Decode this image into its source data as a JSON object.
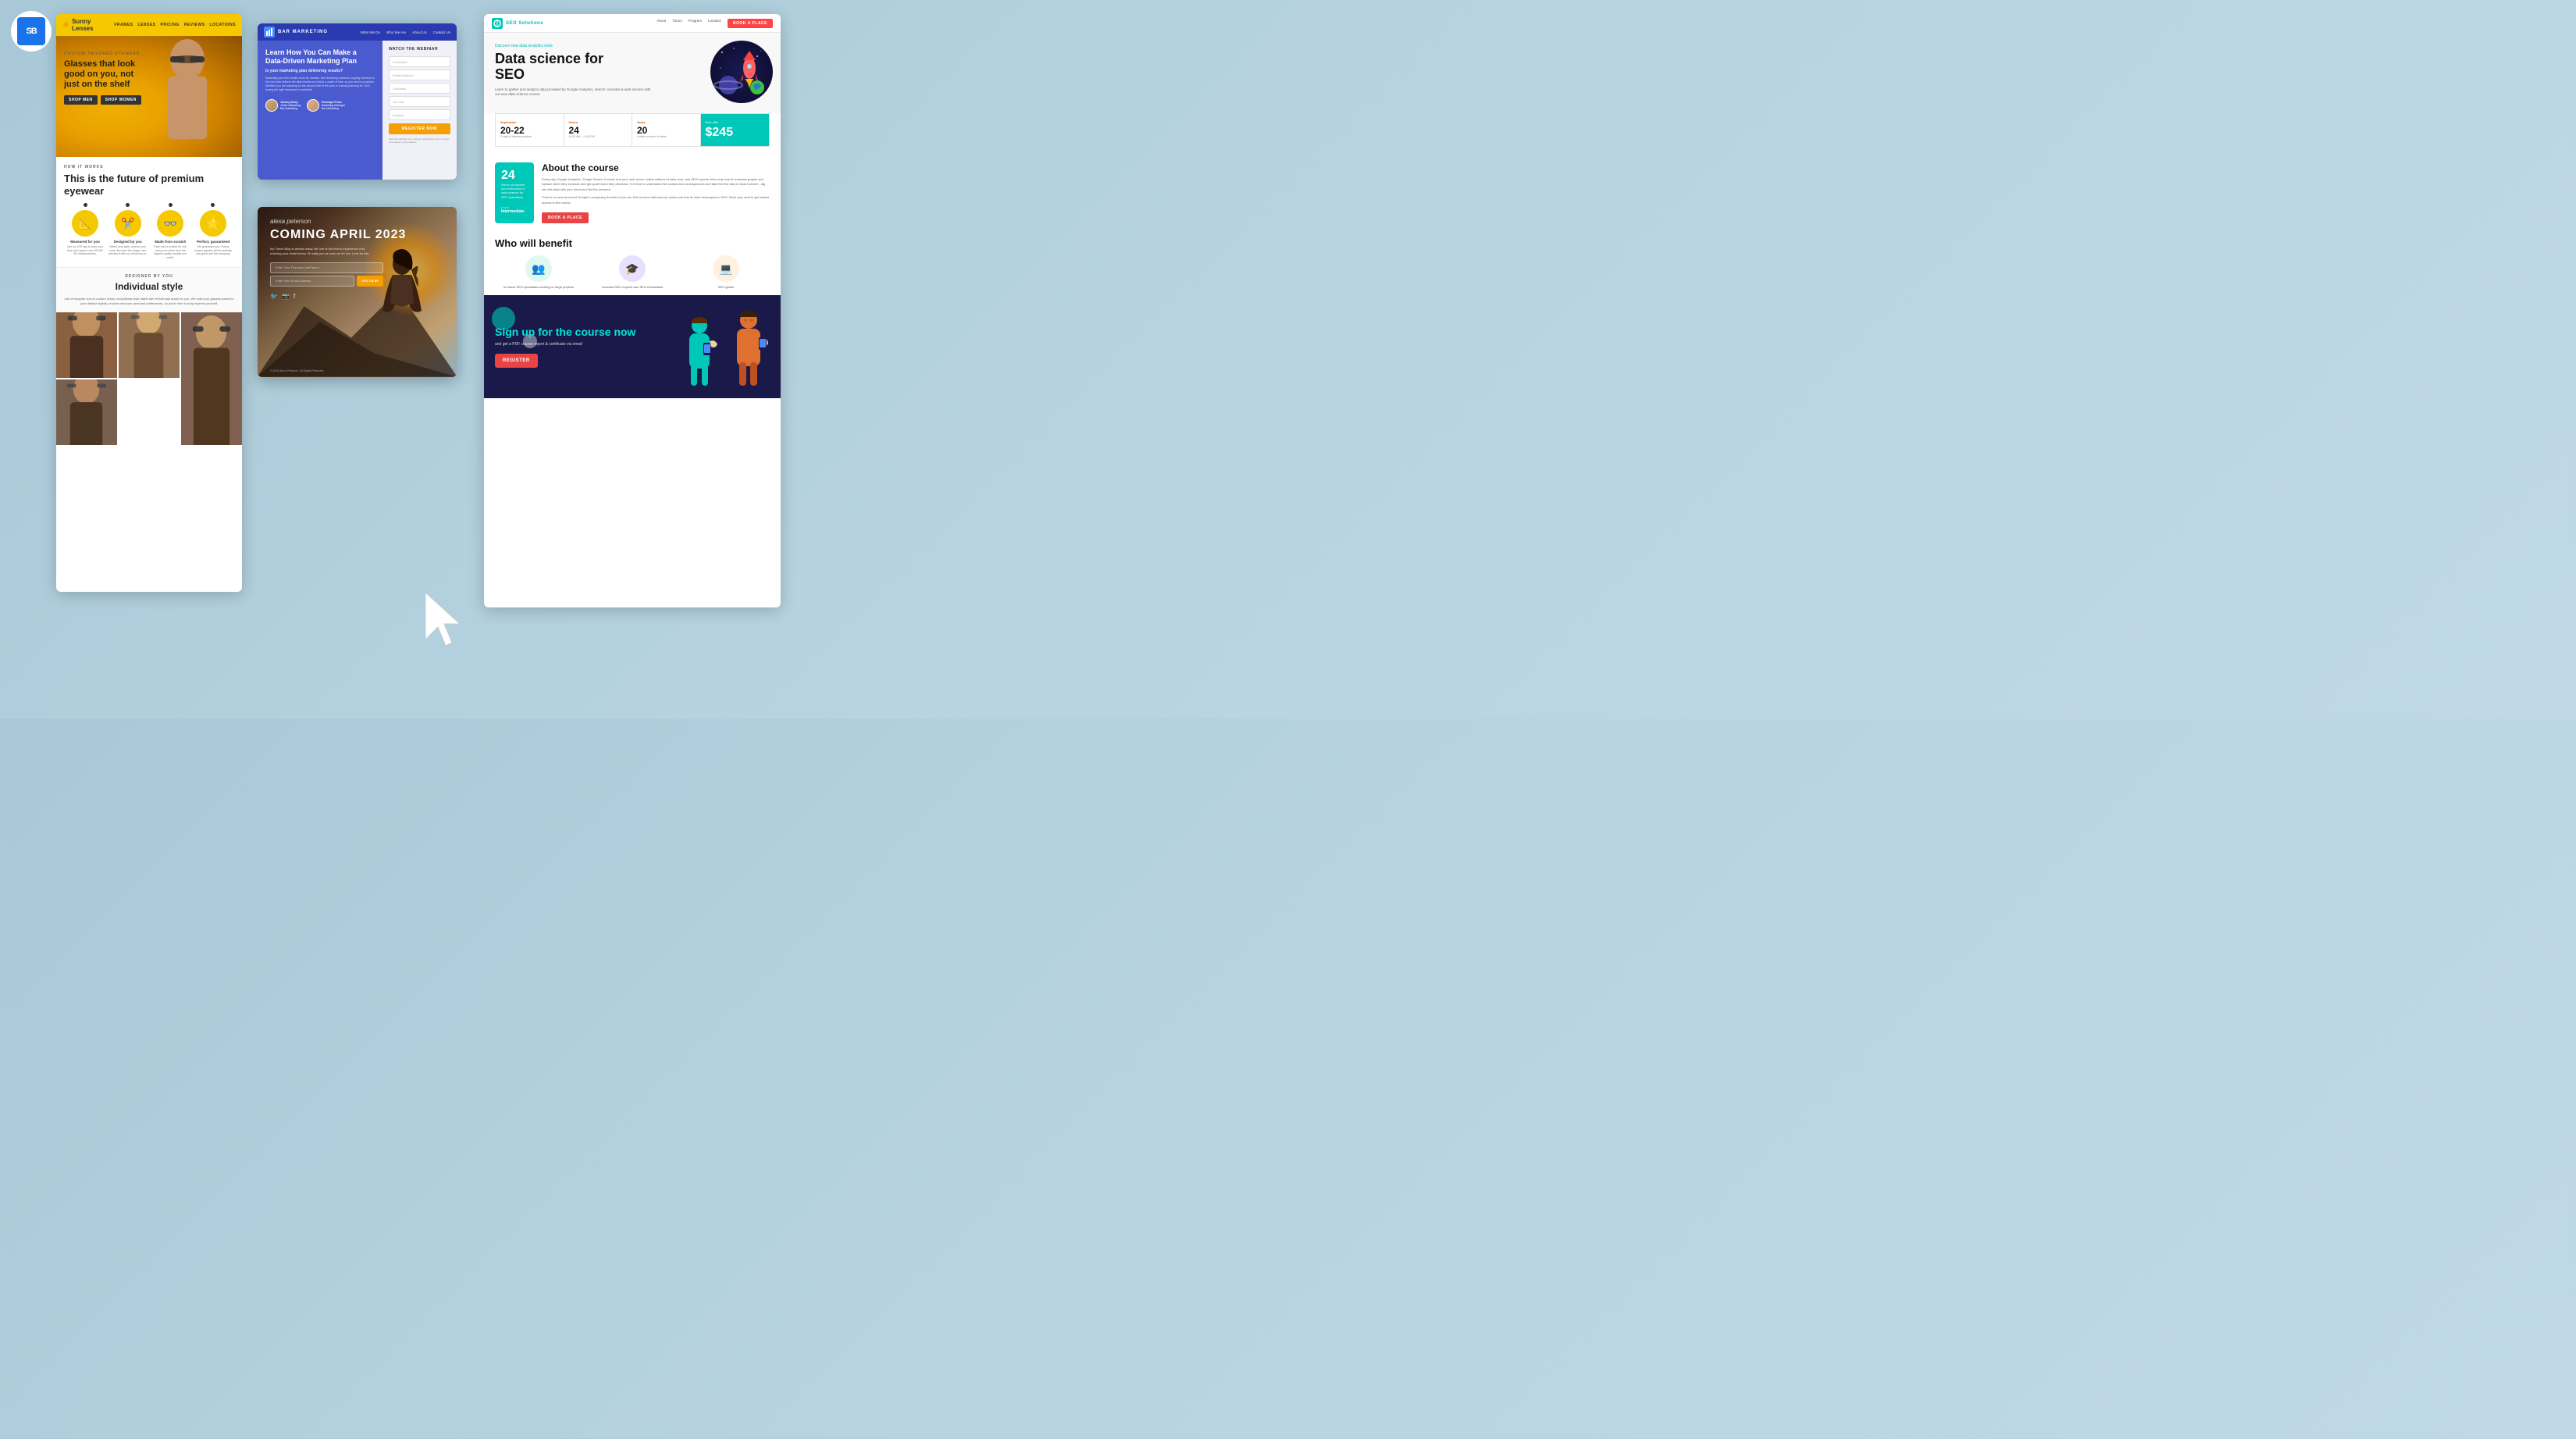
{
  "logo": {
    "text": "SB"
  },
  "panel1": {
    "brand": "Sunny Lenses",
    "nav_items": [
      "FRAMES",
      "LENSES",
      "PRICING",
      "REVIEWS",
      "LOCATIONS"
    ],
    "hero": {
      "custom_label": "CUSTOM-TAILORED EYEWEAR",
      "headline": "Glasses that look good on you, not just on the shelf",
      "btn_men": "SHOP MEN",
      "btn_women": "SHOP WOMEN"
    },
    "how": {
      "label": "HOW IT WORKS",
      "headline": "This is the future of premium eyewear",
      "icons": [
        {
          "emoji": "📐",
          "label": "Measured for you",
          "desc": "Use our iOS app to scan your face and capture over 30,000 3D measurements."
        },
        {
          "emoji": "✂️",
          "label": "Designed by you",
          "desc": "Select your style, choose your color, fine-tune the shape, and preview it with our virtual try-on."
        },
        {
          "emoji": "👓",
          "label": "Made from scratch",
          "desc": "Each pair is crafted for one person at a time from the highest quality acetate and metal."
        },
        {
          "emoji": "⭐",
          "label": "Perfect, guaranteed",
          "desc": "We guarantee your Sunny Lenses glasses will fit perfectly, look great and feel amazing."
        }
      ]
    },
    "designed": {
      "label": "DESIGNED BY YOU",
      "headline": "Individual style",
      "desc": "Like a bespoke suit or couture dress, exceptional style starts with fit that was made for you. We craft your glasses based to your distinct stylistic choices and your personal preferences, so you're free to truly express yourself."
    }
  },
  "panel2": {
    "brand": "BAR MARKETING",
    "nav_items": [
      "What We Do",
      "Who We Are",
      "About Us",
      "Contact Us"
    ],
    "headline": "Learn How You Can Make a Data-Driven Marketing Plan",
    "subhead": "Is your marketing plan delivering results?",
    "body": "Marketing your firm should never be reactive. Bar Marketing conducts ongoing research to find out what delivers the best results and what's a waste of time, so you can be proactive. Whether you are adjusting for the second-half of this year or already planning for 2023, having the right framework is essential.",
    "watch_label": "WATCH THE WEBINAR",
    "fields": [
      "Full Name*",
      "Email Address*",
      "Company",
      "Job Title",
      "Industry"
    ],
    "register_btn": "REGISTER NOW",
    "speakers": [
      {
        "name": "Jeremy Avery",
        "role": "Junior Marketing",
        "company": "Bar Marketing"
      },
      {
        "name": "Penelope Perez",
        "role": "Marketing Manager",
        "company": "Bar Marketing"
      }
    ]
  },
  "panel3": {
    "cursive_name": "alexa peterson",
    "headline": "COMING APRIL 2023",
    "desc": "My Travel Blog is almost ready. Be one of the first to experience it by entering your email below. I'll notify you as soon as it's live. Let's do this",
    "name_placeholder": "Enter Your First and Last Name",
    "email_placeholder": "Enter Your Email Address",
    "submit_btn": "YES, I'M IN!",
    "footer": "© 2023 Alexa Peterson. All Rights Reserved."
  },
  "panel4": {
    "brand": "SEO Solutions",
    "nav_items": [
      "About",
      "Tutors",
      "Program",
      "Location"
    ],
    "book_btn": "BOOK A PLACE",
    "hero": {
      "discover": "Discover new data analytics tools",
      "headline": "Data science for SEO",
      "desc": "Learn to gather and analyze data provided by Google Analytics, search consoles & web servers with our new data science course."
    },
    "stats": [
      {
        "label": "September",
        "num": "20-22",
        "sub": "3 days of intense practice"
      },
      {
        "label": "Hours",
        "num": "24",
        "sub": "10:00 AM — 6:00 PM"
      },
      {
        "label": "Seats",
        "num": "20",
        "sub": "Limited number of seats"
      },
      {
        "label": "Best offer",
        "price": "$245"
      }
    ],
    "about": {
      "title": "About the course",
      "hours": "24",
      "hours_label": "Hours of practice and immersion in data science for SEO specialists",
      "level": "Level",
      "level_val": "Intermediate",
      "desc1": "Every day, Google Analytics, Google Search Console and your web server collect millions of data rows, and SEO experts often only look at summary graphs and replace when they increase and get upset when they decrease. It is time to understand the causes and consequences and take the first step in Data Science - dig into this data with your head and find the answers.",
      "desc2": "There's no need to invent Google's conspiracy theories if you can find out how data science works and test its main techniques in SEO. Book your seat to get instant access to the course.",
      "book_btn": "BOOK A PLACE"
    },
    "who": {
      "title": "Who will benefit",
      "items": [
        {
          "emoji": "👥",
          "label": "In-house SEO specialists working on large projects"
        },
        {
          "emoji": "🎓",
          "label": "Licensed SEO experts and SEO enthusiasts"
        },
        {
          "emoji": "💻",
          "label": "SEO geeks"
        }
      ]
    },
    "signup": {
      "title": "Sign up for the course now",
      "sub": "and get a PDF course report & certificate via email",
      "btn": "REGISTER"
    }
  }
}
